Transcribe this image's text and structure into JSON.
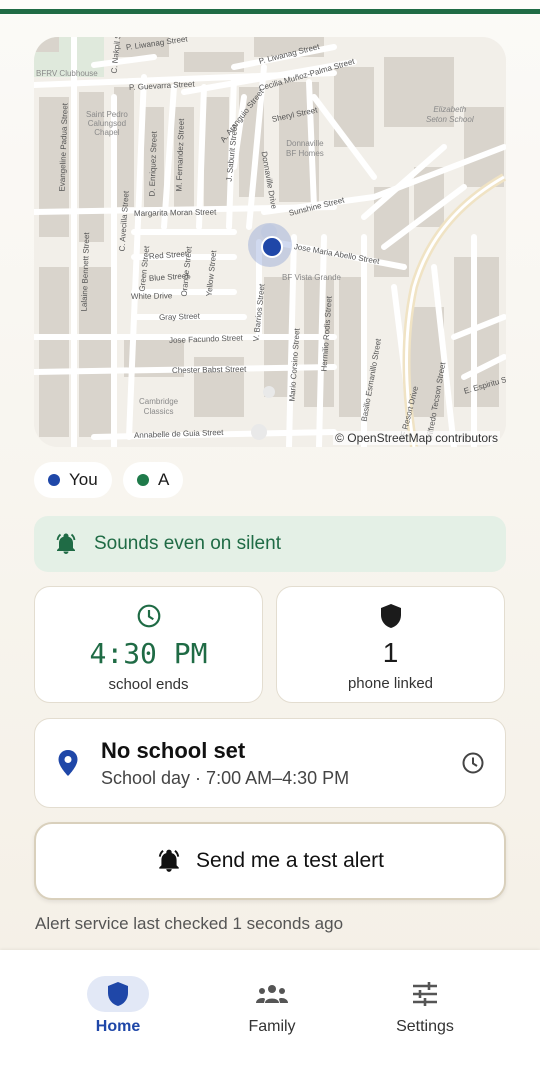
{
  "map": {
    "attribution": "© OpenStreetMap contributors",
    "streets": [
      "P. Liwanag Street",
      "P. Liwanag Street",
      "C. Nakpil Street",
      "P. Guevarra Street",
      "Cecilia Muñoz-Palma Street",
      "Sheryl Street",
      "Donnaville Drive",
      "Margarita Moran Street",
      "Sunshine Street",
      "Jose Maria Abello Street",
      "Red Street",
      "Blue Street",
      "White Drive",
      "Gray Street",
      "Jose Facundo Street",
      "Chester Babst Street",
      "Annabelle de Guia Street",
      "Evangeline Padua Street",
      "Lalaine Bennett Street",
      "Hermilio Rodis Street",
      "Basilio Esmanillo Street",
      "Mario Corsino Street",
      "Wilfredo Tecson Street",
      "BF Resort Drive",
      "E. Espiritu Street",
      "Orange Street",
      "Yellow Street",
      "V. Barrios Street",
      "J. Saburit Street",
      "A. Aranguio Street",
      "C. Avecilla Street",
      "M. Fernandez Street",
      "D. Enriquez Street",
      "Green Street"
    ],
    "places": [
      "BFRV Clubhouse",
      "Saint Pedro\nCalungsod\nChapel",
      "Donnaville\nBF Homes",
      "Elizabeth\nSeton School",
      "BF Vista Grande",
      "Cambridge\nClassics"
    ]
  },
  "legend": {
    "you_label": "You",
    "a_label": "A",
    "you_color": "#1f47a8",
    "a_color": "#1f7a4a"
  },
  "banner": {
    "text": "Sounds even on silent",
    "icon": "bell-icon"
  },
  "stats": {
    "time_value": "4:30 PM",
    "time_label": "school ends",
    "time_icon": "clock-icon",
    "phones_value": "1",
    "phones_label": "phone linked",
    "phones_icon": "shield-icon"
  },
  "school": {
    "title": "No school set",
    "subtitle": "School day · 7:00 AM–4:30 PM",
    "icon": "location-pin-icon",
    "action_icon": "clock-icon"
  },
  "test_alert": {
    "label": "Send me a test alert",
    "icon": "bell-icon"
  },
  "status": {
    "last_checked": "Alert service last checked 1 seconds ago"
  },
  "nav": {
    "items": [
      {
        "label": "Home",
        "icon": "shield-icon",
        "active": true
      },
      {
        "label": "Family",
        "icon": "people-icon",
        "active": false
      },
      {
        "label": "Settings",
        "icon": "sliders-icon",
        "active": false
      }
    ]
  },
  "colors": {
    "accent": "#1f6b45",
    "primary": "#1f47a8",
    "banner_bg": "#e4f0e6"
  }
}
